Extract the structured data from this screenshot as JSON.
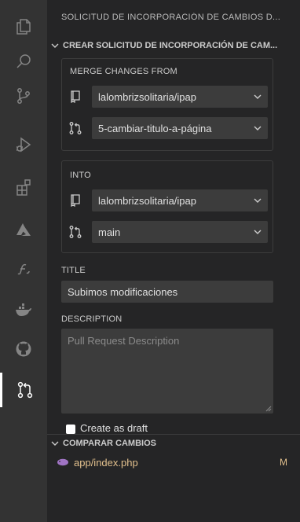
{
  "activity_bar": {
    "items": [
      {
        "name": "explorer",
        "icon": "files-icon"
      },
      {
        "name": "search",
        "icon": "search-icon"
      },
      {
        "name": "source-control",
        "icon": "source-control-icon"
      },
      {
        "name": "run-debug",
        "icon": "run-debug-icon"
      },
      {
        "name": "extensions",
        "icon": "extensions-icon"
      },
      {
        "name": "azure",
        "icon": "azure-icon"
      },
      {
        "name": "symfony",
        "icon": "symfony-icon"
      },
      {
        "name": "docker",
        "icon": "docker-icon"
      },
      {
        "name": "github",
        "icon": "github-icon"
      },
      {
        "name": "pull-requests",
        "icon": "pull-request-icon",
        "active": true
      }
    ]
  },
  "panel": {
    "title": "SOLICITUD DE INCORPORACIÓN DE CAMBIOS D...",
    "create_section": "CREAR SOLICITUD DE INCORPORACIÓN DE CAM...",
    "merge_from": {
      "label": "MERGE CHANGES FROM",
      "repo": "lalombrizsolitaria/ipap",
      "branch": "5-cambiar-titulo-a-página"
    },
    "into": {
      "label": "INTO",
      "repo": "lalombrizsolitaria/ipap",
      "branch": "main"
    },
    "title_field": {
      "label": "TITLE",
      "value": "Subimos modificaciones"
    },
    "description_field": {
      "label": "DESCRIPTION",
      "placeholder": "Pull Request Description"
    },
    "draft_label": "Create as draft",
    "compare_section": "COMPARAR CAMBIOS",
    "files": [
      {
        "name": "app/index.php",
        "status": "M"
      }
    ]
  },
  "colors": {
    "activity_bar": "#333333",
    "panel": "#252526",
    "input": "#3c3c3c",
    "modified": "#e2c08d",
    "php_icon": "#a074c4"
  }
}
